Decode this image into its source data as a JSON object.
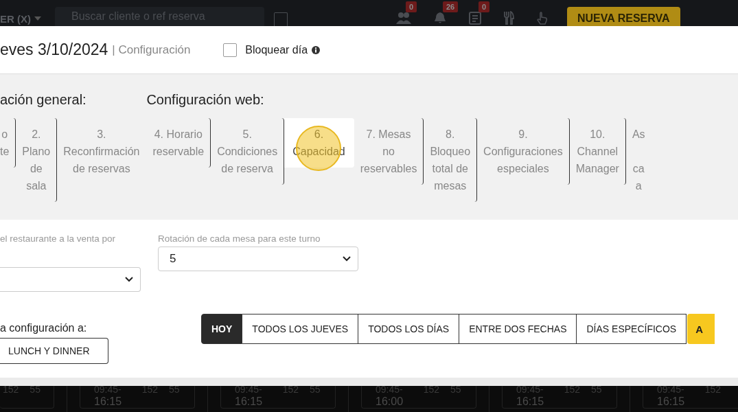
{
  "topbar": {
    "account": "ER (X)",
    "search": {
      "placeholder": "Buscar cliente o ref reserva"
    },
    "checkbox": {
      "checked": false
    },
    "counters": [
      {
        "kind": "people",
        "count": "0"
      },
      {
        "kind": "alert",
        "count": "26"
      },
      {
        "kind": "list",
        "count": "0"
      },
      {
        "kind": "cutlery"
      },
      {
        "kind": "hand"
      }
    ],
    "new_button": "NUEVA RESERVA"
  },
  "modal": {
    "title": "eves 3/10/2024",
    "subtitle": "| Configuración",
    "block_day": {
      "label": "Bloquear día",
      "checked": false
    },
    "groups": [
      {
        "heading": "ación general:",
        "tabs": [
          {
            "label": "o\nte",
            "selected": false
          },
          {
            "label": "2.\nPlano\nde\nsala",
            "selected": false
          },
          {
            "label": "3.\nReconfirmación\nde reservas",
            "selected": false
          }
        ]
      },
      {
        "heading": "Configuración web:",
        "tabs": [
          {
            "label": "4. Horario\nreservable",
            "selected": false
          },
          {
            "label": "5.\nCondiciones\nde reserva",
            "selected": false
          },
          {
            "label": "6.\nCapacidad",
            "selected": true
          },
          {
            "label": "7. Mesas\nno\nreservables",
            "selected": false
          },
          {
            "label": "8.\nBloqueo\ntotal de\nmesas",
            "selected": false
          },
          {
            "label": "9.\nConfiguraciones\nespeciales",
            "selected": false
          },
          {
            "label": "10.\nChannel\nManager",
            "selected": false
          },
          {
            "label": "As\n\nca\na",
            "selected": false
          }
        ]
      }
    ],
    "fields": [
      {
        "label": "el restaurante a la venta por"
      },
      {
        "label": "Rotación de cada mesa para este turno",
        "value": "5"
      }
    ],
    "apply": {
      "label": "a configuración a:",
      "shift_button": "LUNCH Y DINNER",
      "options": [
        {
          "label": "HOY",
          "selected": true
        },
        {
          "label": "TODOS LOS JUEVES",
          "selected": false
        },
        {
          "label": "TODOS LOS DÍAS",
          "selected": false
        },
        {
          "label": "ENTRE DOS FECHAS",
          "selected": false
        },
        {
          "label": "DÍAS ESPECÍFICOS",
          "selected": false
        }
      ],
      "confirm": "A"
    }
  },
  "cards": [
    {
      "covers": "152",
      "count": "55"
    },
    {
      "time_start": "09:45-",
      "covers": "152",
      "count": "55",
      "time_end": "16:15"
    },
    {
      "time_start": "09:45-",
      "covers": "152",
      "count": "55",
      "time_end": "16:15"
    },
    {
      "time_start": "09:45-",
      "covers": "152",
      "count": "55",
      "time_end": "16:00"
    },
    {
      "time_start": "09:45-",
      "covers": "152",
      "count": "55",
      "time_end": "16:15"
    },
    {
      "time_start": "09:45-",
      "covers": "152",
      "time_end": "16:15"
    }
  ]
}
